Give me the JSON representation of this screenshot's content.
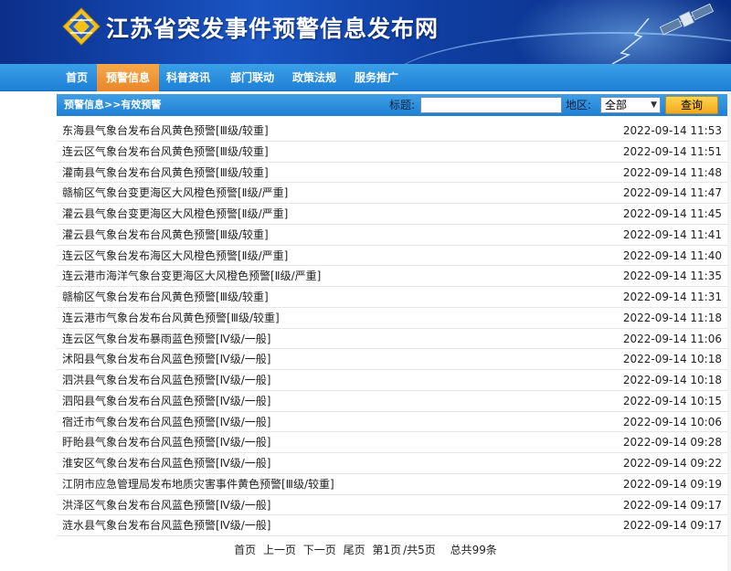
{
  "header": {
    "site_title": "江苏省突发事件预警信息发布网"
  },
  "nav": {
    "items": [
      {
        "label": "首页"
      },
      {
        "label": "预警信息"
      },
      {
        "label": "科普资讯"
      },
      {
        "label": "部门联动"
      },
      {
        "label": "政策法规"
      },
      {
        "label": "服务推广"
      }
    ],
    "active_index": 1
  },
  "searchbar": {
    "breadcrumb": "预警信息>>有效预警",
    "title_label": "标题:",
    "title_value": "",
    "region_label": "地区:",
    "region_selected": "全部",
    "query_label": "查询"
  },
  "list": {
    "items": [
      {
        "title": "东海县气象台发布台风黄色预警[Ⅲ级/较重]",
        "time": "2022-09-14 11:53"
      },
      {
        "title": "连云区气象台发布台风黄色预警[Ⅲ级/较重]",
        "time": "2022-09-14 11:51"
      },
      {
        "title": "灌南县气象台发布台风黄色预警[Ⅲ级/较重]",
        "time": "2022-09-14 11:48"
      },
      {
        "title": "赣榆区气象台变更海区大风橙色预警[Ⅱ级/严重]",
        "time": "2022-09-14 11:47"
      },
      {
        "title": "灌云县气象台变更海区大风橙色预警[Ⅱ级/严重]",
        "time": "2022-09-14 11:45"
      },
      {
        "title": "灌云县气象台发布台风黄色预警[Ⅲ级/较重]",
        "time": "2022-09-14 11:41"
      },
      {
        "title": "连云区气象台发布海区大风橙色预警[Ⅱ级/严重]",
        "time": "2022-09-14 11:40"
      },
      {
        "title": "连云港市海洋气象台变更海区大风橙色预警[Ⅱ级/严重]",
        "time": "2022-09-14 11:35"
      },
      {
        "title": "赣榆区气象台发布台风黄色预警[Ⅲ级/较重]",
        "time": "2022-09-14 11:31"
      },
      {
        "title": "连云港市气象台发布台风黄色预警[Ⅲ级/较重]",
        "time": "2022-09-14 11:18"
      },
      {
        "title": "连云区气象台发布暴雨蓝色预警[Ⅳ级/一般]",
        "time": "2022-09-14 11:06"
      },
      {
        "title": "沭阳县气象台发布台风蓝色预警[Ⅳ级/一般]",
        "time": "2022-09-14 10:18"
      },
      {
        "title": "泗洪县气象台发布台风蓝色预警[Ⅳ级/一般]",
        "time": "2022-09-14 10:18"
      },
      {
        "title": "泗阳县气象台发布台风蓝色预警[Ⅳ级/一般]",
        "time": "2022-09-14 10:15"
      },
      {
        "title": "宿迁市气象台发布台风蓝色预警[Ⅳ级/一般]",
        "time": "2022-09-14 10:06"
      },
      {
        "title": "盱眙县气象台发布台风蓝色预警[Ⅳ级/一般]",
        "time": "2022-09-14 09:28"
      },
      {
        "title": "淮安区气象台发布台风蓝色预警[Ⅳ级/一般]",
        "time": "2022-09-14 09:22"
      },
      {
        "title": "江阴市应急管理局发布地质灾害事件黄色预警[Ⅲ级/较重]",
        "time": "2022-09-14 09:19"
      },
      {
        "title": "洪泽区气象台发布台风蓝色预警[Ⅳ级/一般]",
        "time": "2022-09-14 09:17"
      },
      {
        "title": "涟水县气象台发布台风蓝色预警[Ⅳ级/一般]",
        "time": "2022-09-14 09:17"
      }
    ]
  },
  "pager": {
    "first": "首页",
    "prev": "上一页",
    "next": "下一页",
    "last": "尾页",
    "current": "第1页",
    "total_pages": "/共5页",
    "total_items": "总共99条"
  },
  "colors": {
    "banner": "#1a55c4",
    "nav": "#2b8fdf",
    "nav_active": "#ef962f",
    "query_button": "#f7c03a"
  }
}
